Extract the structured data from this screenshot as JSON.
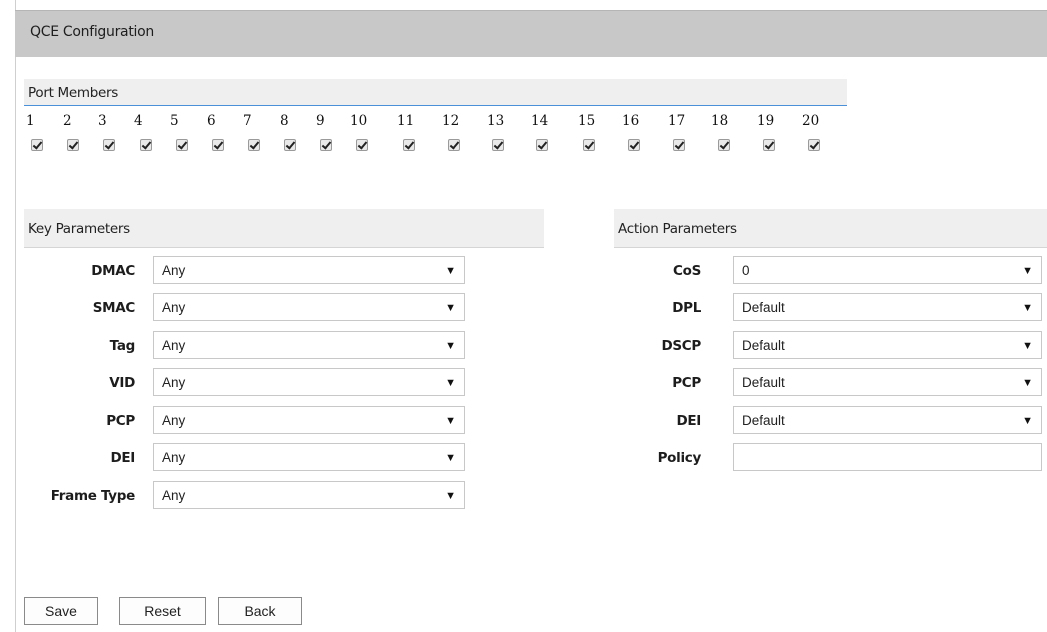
{
  "title": "QCE Configuration",
  "port_members": {
    "heading": "Port Members",
    "ports": [
      "1",
      "2",
      "3",
      "4",
      "5",
      "6",
      "7",
      "8",
      "9",
      "10",
      "11",
      "12",
      "13",
      "14",
      "15",
      "16",
      "17",
      "18",
      "19",
      "20"
    ],
    "checked": [
      true,
      true,
      true,
      true,
      true,
      true,
      true,
      true,
      true,
      true,
      true,
      true,
      true,
      true,
      true,
      true,
      true,
      true,
      true,
      true
    ]
  },
  "key_parameters": {
    "heading": "Key Parameters",
    "fields": [
      {
        "label": "DMAC",
        "value": "Any"
      },
      {
        "label": "SMAC",
        "value": "Any"
      },
      {
        "label": "Tag",
        "value": "Any"
      },
      {
        "label": "VID",
        "value": "Any"
      },
      {
        "label": "PCP",
        "value": "Any"
      },
      {
        "label": "DEI",
        "value": "Any"
      },
      {
        "label": "Frame Type",
        "value": "Any"
      }
    ]
  },
  "action_parameters": {
    "heading": "Action Parameters",
    "fields": [
      {
        "label": "CoS",
        "value": "0"
      },
      {
        "label": "DPL",
        "value": "Default"
      },
      {
        "label": "DSCP",
        "value": "Default"
      },
      {
        "label": "PCP",
        "value": "Default"
      },
      {
        "label": "DEI",
        "value": "Default"
      }
    ],
    "policy": {
      "label": "Policy",
      "value": ""
    }
  },
  "buttons": {
    "save": "Save",
    "reset": "Reset",
    "back": "Back"
  },
  "icons": {
    "dropdown": "chevron-down-icon",
    "check": "checkmark-icon"
  }
}
